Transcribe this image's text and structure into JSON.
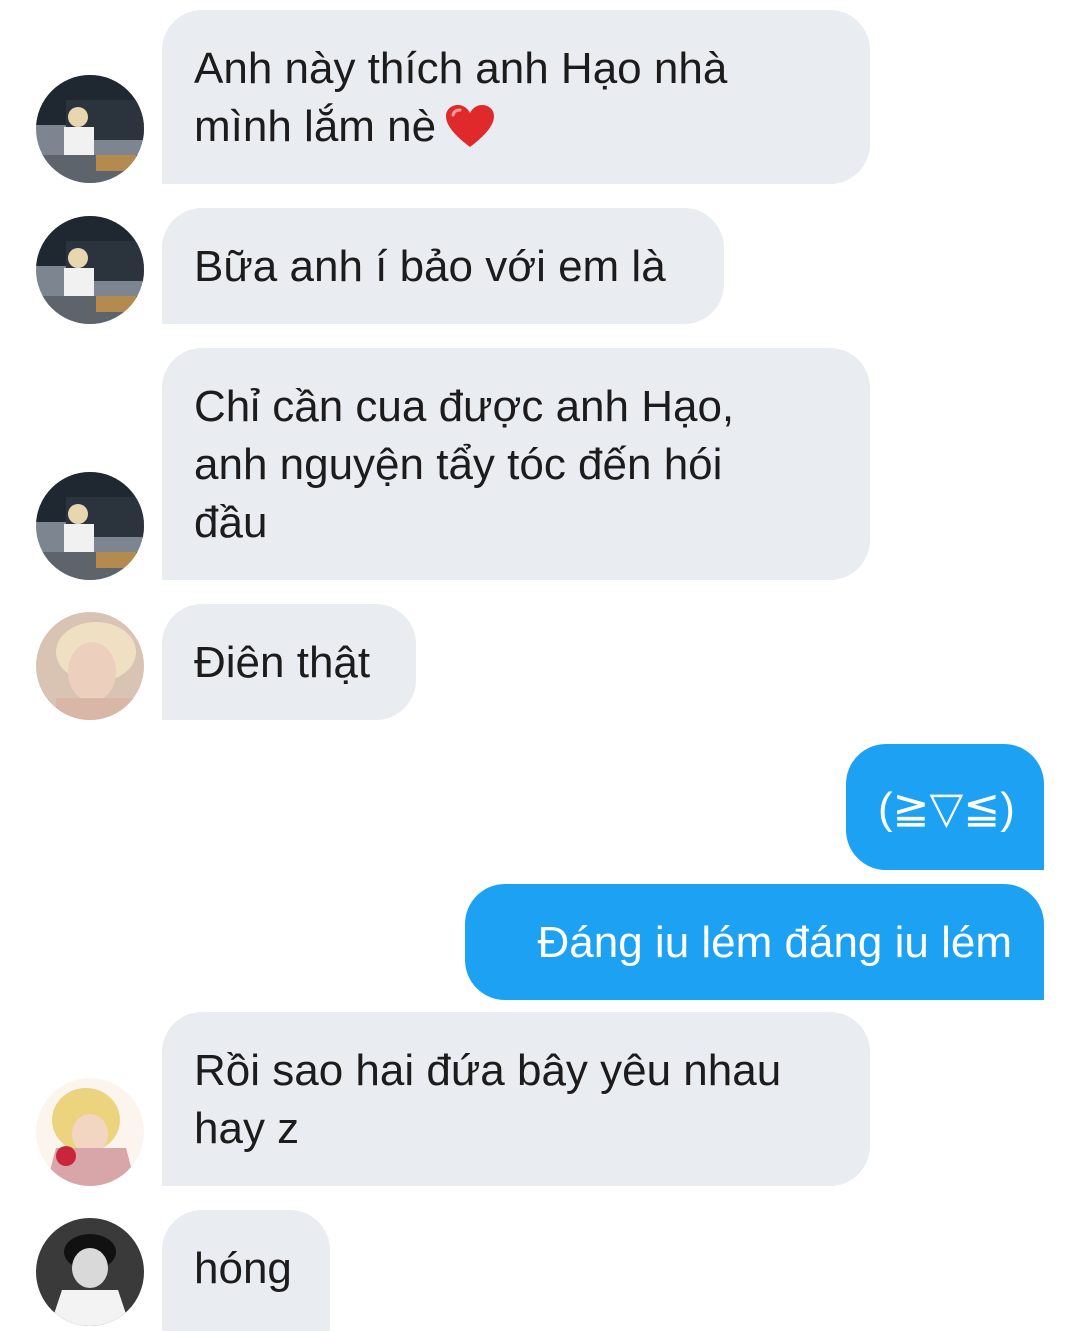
{
  "messages": [
    {
      "side": "in",
      "avatar": "avatar-car",
      "text": "Anh này thích anh Hạo nhà\nmình lắm nè",
      "emoji": "red-heart-icon"
    },
    {
      "side": "in",
      "avatar": "avatar-car",
      "text": "Bữa anh í bảo với em là"
    },
    {
      "side": "in",
      "avatar": "avatar-car",
      "text": "Chỉ cần cua được anh Hạo,\nanh nguyện tẩy tóc đến hói\nđầu"
    },
    {
      "side": "in",
      "avatar": "avatar-blonde",
      "text": "Điên thật"
    },
    {
      "side": "out",
      "text": "(≧▽≦)"
    },
    {
      "side": "out",
      "text": "Đáng iu lém đáng iu lém"
    },
    {
      "side": "in",
      "avatar": "avatar-flower",
      "text": "Rồi sao hai đứa bây yêu nhau\nhay z"
    },
    {
      "side": "in",
      "avatar": "avatar-bw",
      "text": "hóng"
    }
  ],
  "colors": {
    "incoming_bubble": "#e9edf1",
    "outgoing_bubble": "#1da1f2",
    "heart": "#e0292b"
  }
}
